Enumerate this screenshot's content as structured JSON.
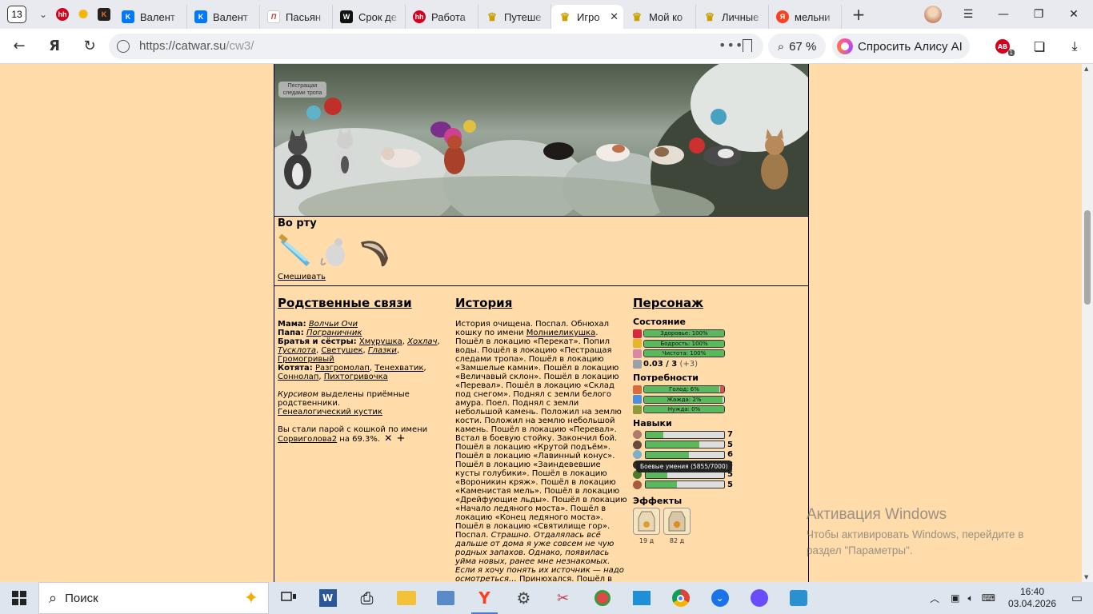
{
  "browser": {
    "tab_count": "13",
    "tabs": [
      {
        "label": "Валент",
        "icon": "vk"
      },
      {
        "label": "Валент",
        "icon": "vk"
      },
      {
        "label": "Пасьян",
        "icon": "pas"
      },
      {
        "label": "Срок де",
        "icon": "w"
      },
      {
        "label": "Работа",
        "icon": "hh"
      },
      {
        "label": "Путеше",
        "icon": "cw"
      },
      {
        "label": "Игро",
        "icon": "cw",
        "active": true
      },
      {
        "label": "Мой ко",
        "icon": "cw"
      },
      {
        "label": "Личные",
        "icon": "cw"
      },
      {
        "label": "мельни",
        "icon": "ya"
      }
    ],
    "url_host": "https://catwar.su",
    "url_path": "/cw3/",
    "zoom": "67 %",
    "alice_label": "Спросить Алису AI",
    "ext_badge": "1"
  },
  "scene": {
    "location_label": "Пестращая следами тропа"
  },
  "mouth": {
    "title": "Во рту",
    "mix_link": "Смешивать"
  },
  "relations": {
    "title": "Родственные связи",
    "mother_label": "Мама:",
    "mother": "Волчьи Очи",
    "father_label": "Папа:",
    "father": "Пограничник",
    "siblings_label": "Братья и сёстры:",
    "siblings": [
      "Хмурушка",
      "Хохлач",
      "Тусклота",
      "Светушек",
      "Глазки",
      "Громогривый"
    ],
    "kittens_label": "Котята:",
    "kittens": [
      "Разгромолап",
      "Тенехватик",
      "Соннолап",
      "Пихтогривочка"
    ],
    "assigned_name": "Курсивом",
    "assigned_text": "выделены приёмные родственники.",
    "tree_link": "Генеалогический кустик",
    "pair_text": "Вы стали парой с кошкой по имени",
    "pair_name": "Сорвиголова2",
    "pair_percent": "на 69.3%.",
    "pair_remove": "✕",
    "pair_add": "+"
  },
  "history": {
    "title": "История",
    "p1": "История очищена. Поспал. Обнюхал кошку по имени ",
    "p1_link": "Молниеликушка",
    "p2": ". Пошёл в локацию «Перекат». Попил воды. Пошёл в локацию «Пестращая следами тропа». Пошёл в локацию «Замшелые камни». Пошёл в локацию «Величавый склон». Пошёл в локацию «Перевал». Пошёл в локацию «Склад под снегом». Поднял с земли белого амура. Поел. Поднял с земли небольшой камень. Положил на землю кости. Положил на землю небольшой камень. Пошёл в локацию «Перевал». Встал в боевую стойку. Закончил бой. Пошёл в локацию «Крутой подъём». Пошёл в локацию «Лавинный конус». Пошёл в локацию «Заиндевевшие кусты голубики». Пошёл в локацию «Вороникин кряж». Пошёл в локацию «Каменистая мель». Пошёл в локацию «Дрейфующие льды». Пошёл в локацию «Начало ледяного моста». Пошёл в локацию «Конец ледяного моста». Пошёл в локацию «Святилище гор». Поспал. ",
    "p3_italic": "Страшно. Отдалялась всё дальше от дома я уже совсем не чую родных запахов. Однако, появилась уйма новых, ранее мне незнакомых. Если я хочу понять их источник — надо осмотреться…",
    "p4": " Принюхался. Пошёл в локацию «Холодные земли». Пошёл в локацию «Холодные земли». Пошёл в локацию «Холодные"
  },
  "character": {
    "title": "Персонаж",
    "state_title": "Состояние",
    "state": [
      {
        "label": "Здоровье: 100%",
        "value": 100,
        "color": "#d9263a"
      },
      {
        "label": "Бодрость: 100%",
        "value": 100,
        "color": "#e8b52a"
      },
      {
        "label": "Чистота: 100%",
        "value": 100,
        "color": "#d88aa5"
      }
    ],
    "weight_value": "0.03 / 3",
    "weight_delta": "(+3)",
    "needs_title": "Потребности",
    "needs": [
      {
        "label": "Голод: 6%",
        "value": 94,
        "color": "#d86a3c",
        "red": true
      },
      {
        "label": "Жажда: 2%",
        "value": 98,
        "color": "#4a8fe0"
      },
      {
        "label": "Нужда: 0%",
        "value": 100,
        "color": "#8a9b3c"
      }
    ],
    "skills_title": "Навыки",
    "skills": [
      {
        "level": "7",
        "value": 22,
        "color": "#b07a6a"
      },
      {
        "level": "5",
        "value": 68,
        "color": "#6a4a3a"
      },
      {
        "level": "6",
        "value": 55,
        "color": "#7ab0c8"
      },
      {
        "level": "8",
        "value": 85,
        "color": "#3a2a1a"
      },
      {
        "level": "5",
        "value": 28,
        "color": "#4a7a2a"
      },
      {
        "level": "5",
        "value": 40,
        "color": "#a85a3a"
      }
    ],
    "tooltip": "Боевые умения (5855/7000)",
    "effects_title": "Эффекты",
    "effects": [
      {
        "duration": "19 д"
      },
      {
        "duration": "82 д"
      }
    ]
  },
  "windows": {
    "activation_title": "Активация Windows",
    "activation_line1": "Чтобы активировать Windows, перейдите в",
    "activation_line2": "раздел \"Параметры\".",
    "search_placeholder": "Поиск",
    "time": "16:40",
    "date": "03.04.2026"
  }
}
